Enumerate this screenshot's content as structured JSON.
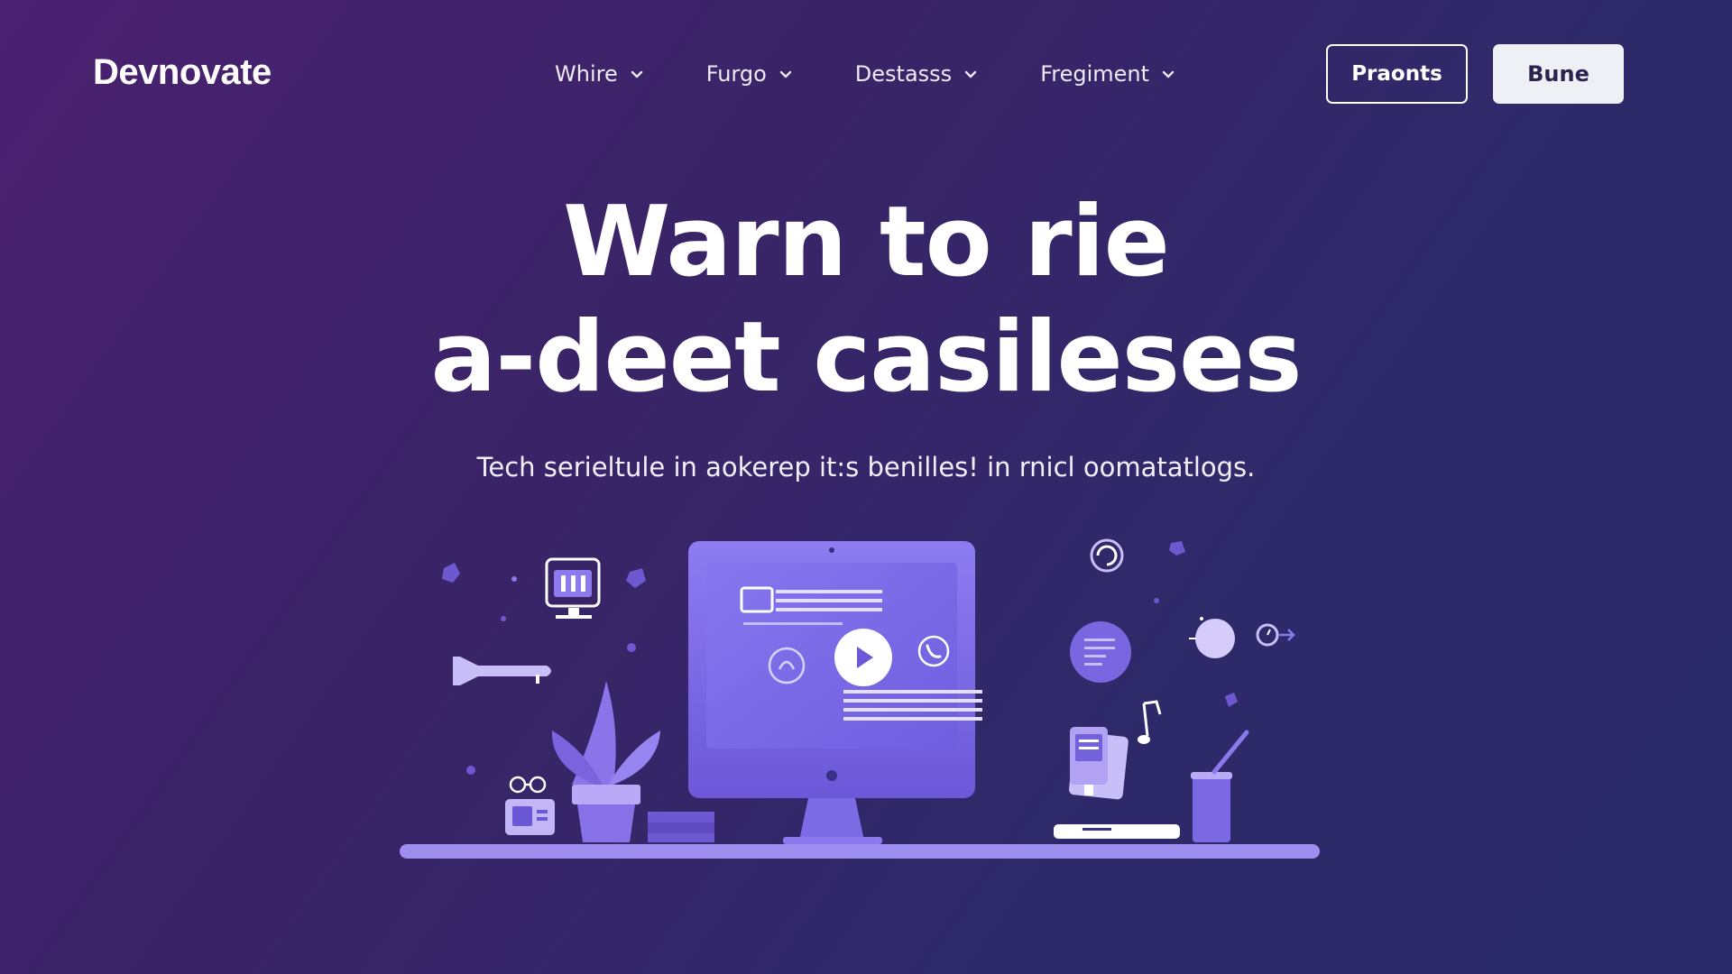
{
  "brand": {
    "logo_text": "Devnovate"
  },
  "nav": {
    "items": [
      {
        "label": "Whire",
        "icon": "chevron-down-icon"
      },
      {
        "label": "Furgo",
        "icon": "chevron-down-icon"
      },
      {
        "label": "Destasss",
        "icon": "chevron-down-icon"
      },
      {
        "label": "Fregiment",
        "icon": "chevron-down-icon"
      }
    ],
    "outline_button": "Praonts",
    "solid_button": "Bune"
  },
  "hero": {
    "title_line1": "Warn to rie",
    "title_line2": "a-deet casileses",
    "subtitle": "Tech serieltule in aokerep it:s benilles! in rnicl oomatatlogs."
  },
  "colors": {
    "background_start": "#4a2070",
    "background_end": "#2a2a68",
    "accent": "#7a68e8",
    "button_solid_bg": "#eef0f6",
    "button_solid_text": "#2a2350"
  },
  "illustration": {
    "icons": [
      "desk-icon",
      "monitor-icon",
      "play-icon",
      "plant-pot-icon",
      "phone-call-icon",
      "document-circle-icon",
      "music-note-icon",
      "pencil-cup-icon",
      "glasses-icon",
      "small-monitor-icon",
      "books-icon",
      "clock-arrow-icon",
      "laptop-icon",
      "horn-icon"
    ]
  }
}
